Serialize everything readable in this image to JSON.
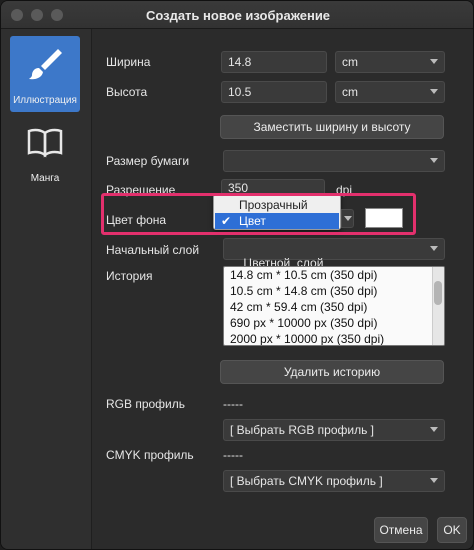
{
  "window": {
    "title": "Создать новое изображение"
  },
  "sidebar": {
    "items": [
      {
        "label": "Иллюстрация",
        "icon": "brush-icon",
        "active": true
      },
      {
        "label": "Манга",
        "icon": "book-icon",
        "active": false
      }
    ]
  },
  "form": {
    "width": {
      "label": "Ширина",
      "value": "14.8",
      "unit": "cm"
    },
    "height": {
      "label": "Высота",
      "value": "10.5",
      "unit": "cm"
    },
    "swap_button": "Заместить ширину и высоту",
    "paper_size": {
      "label": "Размер бумаги",
      "value": ""
    },
    "resolution": {
      "label": "Разрешение",
      "value": "350",
      "unit": "dpi"
    },
    "bg_color": {
      "label": "Цвет фона",
      "options": [
        "Прозрачный",
        "Цвет"
      ],
      "selected": "Цвет",
      "swatch_color": "#ffffff"
    },
    "initial_layer": {
      "label": "Начальный слой",
      "value": "Цветной  слой"
    },
    "history": {
      "label": "История",
      "items": [
        "14.8 cm * 10.5 cm (350 dpi)",
        "10.5 cm * 14.8 cm (350 dpi)",
        "42 cm * 59.4 cm (350 dpi)",
        "690 px * 10000 px (350 dpi)",
        "2000 px * 10000 px (350 dpi)"
      ],
      "clear_button": "Удалить историю"
    },
    "rgb_profile": {
      "label": "RGB профиль",
      "value": "-----",
      "select": "[ Выбрать RGB профиль ]"
    },
    "cmyk_profile": {
      "label": "CMYK профиль",
      "value": "-----",
      "select": "[ Выбрать CMYK профиль ]"
    }
  },
  "footer": {
    "cancel": "Отмена",
    "ok": "OK"
  },
  "colors": {
    "accent": "#3d78c9",
    "highlight": "#e3306d",
    "selection": "#2e6fd6"
  }
}
